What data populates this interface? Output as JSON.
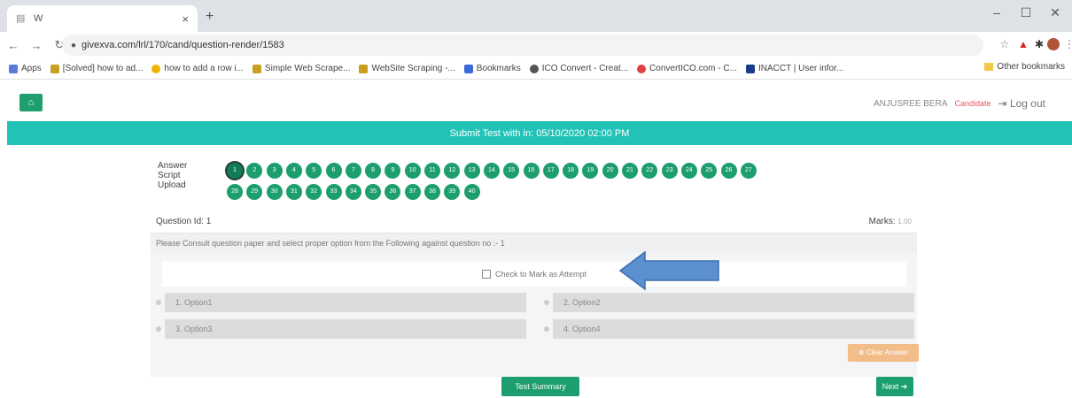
{
  "browser": {
    "tab_title": "W",
    "tab_close": "×",
    "new_tab": "+",
    "url": "givexva.com/lrl/170/cand/question-render/1583",
    "window_controls": [
      "–",
      "☐",
      "✕"
    ],
    "bookmarks": [
      {
        "label": "Apps",
        "color": "#5a7bd8"
      },
      {
        "label": "[Solved] how to ad...",
        "color": "#c8a020"
      },
      {
        "label": "how to add a row i...",
        "color": "#f0b400"
      },
      {
        "label": "Simple Web Scrape...",
        "color": "#c8a020"
      },
      {
        "label": "WebSite Scraping -...",
        "color": "#c8a020"
      },
      {
        "label": "Bookmarks",
        "color": "#3a6bd8"
      },
      {
        "label": "ICO Convert - Creat...",
        "color": "#555555"
      },
      {
        "label": "ConvertICO.com - C...",
        "color": "#e04040"
      },
      {
        "label": "INACCT | User infor...",
        "color": "#1a3a8a"
      }
    ],
    "other_bookmarks": "Other bookmarks"
  },
  "header": {
    "user_name": "ANJUSREE BERA",
    "user_role": "Candidate",
    "logout_label": "Log out"
  },
  "banner": {
    "text": "Submit Test with in: 05/10/2020 02:00 PM"
  },
  "palette": {
    "label": "Answer Script Upload",
    "row1": [
      "1",
      "2",
      "3",
      "4",
      "5",
      "6",
      "7",
      "8",
      "9",
      "10",
      "11",
      "12",
      "13",
      "14",
      "15",
      "16",
      "17",
      "18",
      "19",
      "20",
      "21",
      "22",
      "23",
      "24",
      "25",
      "26",
      "27"
    ],
    "row2": [
      "28",
      "29",
      "30",
      "31",
      "32",
      "33",
      "34",
      "35",
      "36",
      "37",
      "38",
      "39",
      "40"
    ],
    "current": "1"
  },
  "question": {
    "id_label": "Question Id: 1",
    "marks_label": "Marks:",
    "marks_value": "1.00",
    "text": "Please Consult question paper and select proper option from the Following against question no :- 1",
    "attempt_label": "Check to Mark as Attempt",
    "options": [
      "1. Option1",
      "2. Option2",
      "3. Option3",
      "4. Option4"
    ],
    "clear_label": "⊗ Clear Answer"
  },
  "footer": {
    "summary_label": "Test Summary",
    "next_label": "Next ➔"
  },
  "colors": {
    "teal_banner": "#22c3b6",
    "green_button": "#1d9e6e",
    "annotation_arrow": "#5b8fd0",
    "clear_button": "#f3bd8a"
  }
}
